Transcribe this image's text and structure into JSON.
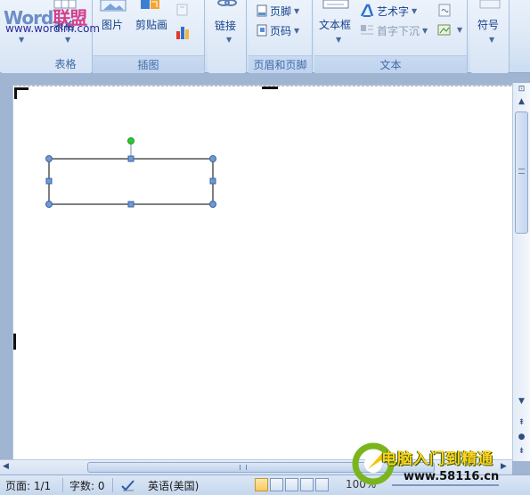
{
  "logo": {
    "brand_latin": "Word",
    "brand_cn": "联盟",
    "url": "www.wordlm.com"
  },
  "ribbon": {
    "groups": {
      "table": {
        "label": "表格",
        "button": "表格"
      },
      "illustrations": {
        "label": "插图",
        "picture": "图片",
        "clipart": "剪贴画"
      },
      "links": {
        "button": "链接"
      },
      "header_footer": {
        "label": "页眉和页脚",
        "footer": "页脚",
        "page_number": "页码"
      },
      "text": {
        "label": "文本",
        "textbox": "文本框",
        "wordart": "艺术字",
        "dropcap": "首字下沉"
      },
      "symbols": {
        "button": "符号"
      }
    }
  },
  "status_bar": {
    "page": "页面: 1/1",
    "words": "字数: 0",
    "language": "英语(美国)",
    "zoom": "100%"
  },
  "watermark": {
    "title": "电脑入门到精通",
    "url": "www.58116.cn"
  },
  "colors": {
    "ribbon_bg": "#dce8f6",
    "doc_bg": "#9fb5d2",
    "shape_handle": "#5b8ed6",
    "rotate_handle": "#1fcf2a"
  }
}
